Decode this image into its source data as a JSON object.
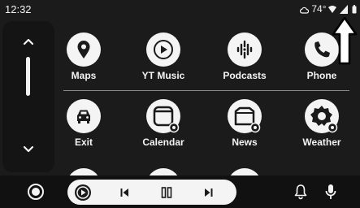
{
  "status": {
    "time": "12:32",
    "temperature": "74°",
    "weather_icon": "cloud-icon",
    "icons": [
      "wifi-icon",
      "signal-icon",
      "battery-icon"
    ]
  },
  "sidebar": {
    "up_icon": "chevron-up-icon",
    "down_icon": "chevron-down-icon"
  },
  "apps": [
    {
      "label": "Maps",
      "icon": "map-pin-icon"
    },
    {
      "label": "YT Music",
      "icon": "play-circle-icon"
    },
    {
      "label": "Podcasts",
      "icon": "podcast-icon"
    },
    {
      "label": "Phone",
      "icon": "phone-icon"
    },
    {
      "label": "Exit",
      "icon": "car-icon"
    },
    {
      "label": "Calendar",
      "icon": "calendar-icon"
    },
    {
      "label": "News",
      "icon": "news-icon"
    },
    {
      "label": "Weather",
      "icon": "weather-icon"
    }
  ],
  "annotation": {
    "icon": "arrow-up-icon"
  },
  "bottom_bar": {
    "home_icon": "home-icon",
    "media_app_icon": "play-circle-icon",
    "controls": [
      "skip-previous-icon",
      "pause-icon",
      "skip-next-icon"
    ],
    "notification_icon": "bell-icon",
    "voice_icon": "mic-icon"
  }
}
